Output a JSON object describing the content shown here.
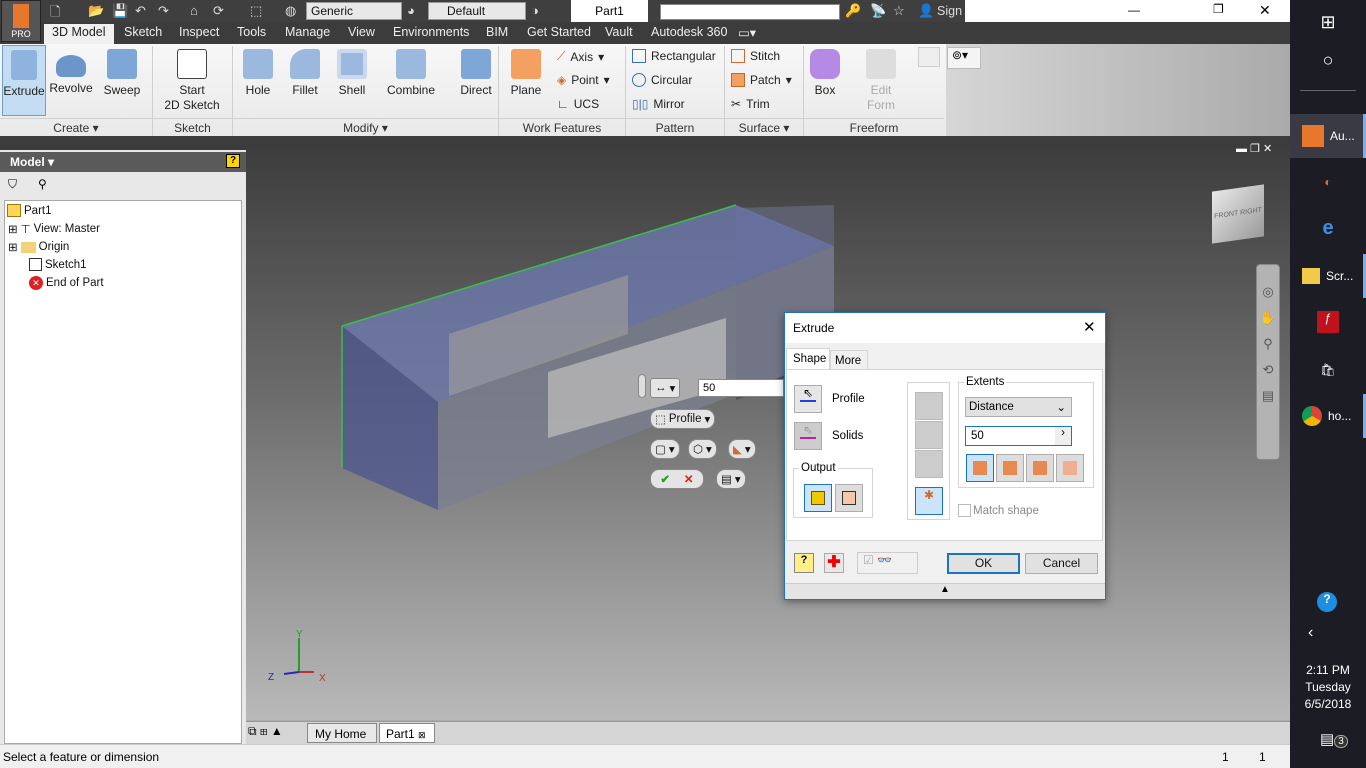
{
  "app": {
    "logo_label": "PRO",
    "document_title": "Part1",
    "material": "Generic",
    "appearance": "Default",
    "search_placeholder": "",
    "sign_in": "Sign In"
  },
  "window_controls": {
    "minimize": "—",
    "restore": "❐",
    "close": "✕"
  },
  "tabs": [
    "3D Model",
    "Sketch",
    "Inspect",
    "Tools",
    "Manage",
    "View",
    "Environments",
    "BIM",
    "Get Started",
    "Vault",
    "Autodesk 360"
  ],
  "ribbon": {
    "create": {
      "label": "Create",
      "items": [
        "Extrude",
        "Revolve",
        "Sweep"
      ]
    },
    "sketch": {
      "label": "Sketch",
      "start_line1": "Start",
      "start_line2": "2D Sketch"
    },
    "modify": {
      "label": "Modify",
      "items": [
        "Hole",
        "Fillet",
        "Shell",
        "Combine",
        "Direct"
      ]
    },
    "work_features": {
      "label": "Work Features",
      "plane": "Plane",
      "axis": "Axis",
      "point": "Point",
      "ucs": "UCS"
    },
    "pattern": {
      "label": "Pattern",
      "items": [
        "Rectangular",
        "Circular",
        "Mirror"
      ]
    },
    "surface": {
      "label": "Surface",
      "items": [
        "Stitch",
        "Patch",
        "Trim"
      ]
    },
    "freeform": {
      "label": "Freeform",
      "box": "Box",
      "edit_line1": "Edit",
      "edit_line2": "Form"
    }
  },
  "browser": {
    "title": "Model",
    "tree": [
      "Part1",
      "View: Master",
      "Origin",
      "Sketch1",
      "End of Part"
    ]
  },
  "viewcube": {
    "front": "FRONT",
    "right": "RIGHT"
  },
  "minitoolbar": {
    "distance": "50",
    "profile": "Profile"
  },
  "triad": {
    "x": "X",
    "y": "Y",
    "z": "Z"
  },
  "dialog": {
    "title": "Extrude",
    "tabs": [
      "Shape",
      "More"
    ],
    "profile": "Profile",
    "solids": "Solids",
    "output": "Output",
    "extents": "Extents",
    "extents_type": "Distance",
    "distance": "50",
    "match_shape": "Match shape",
    "ok": "OK",
    "cancel": "Cancel"
  },
  "doc_tabs": [
    "My Home",
    "Part1"
  ],
  "status": {
    "message": "Select a feature or dimension",
    "count1": "1",
    "count2": "1"
  },
  "taskbar": {
    "items": [
      "Au...",
      "Scr...",
      "ho..."
    ],
    "time": "2:11 PM",
    "day": "Tuesday",
    "date": "6/5/2018",
    "notifications": "3"
  },
  "colors": {
    "accent": "#1e73be",
    "ribbon_dark": "#3c3c3c",
    "logo": "#e8772e"
  }
}
